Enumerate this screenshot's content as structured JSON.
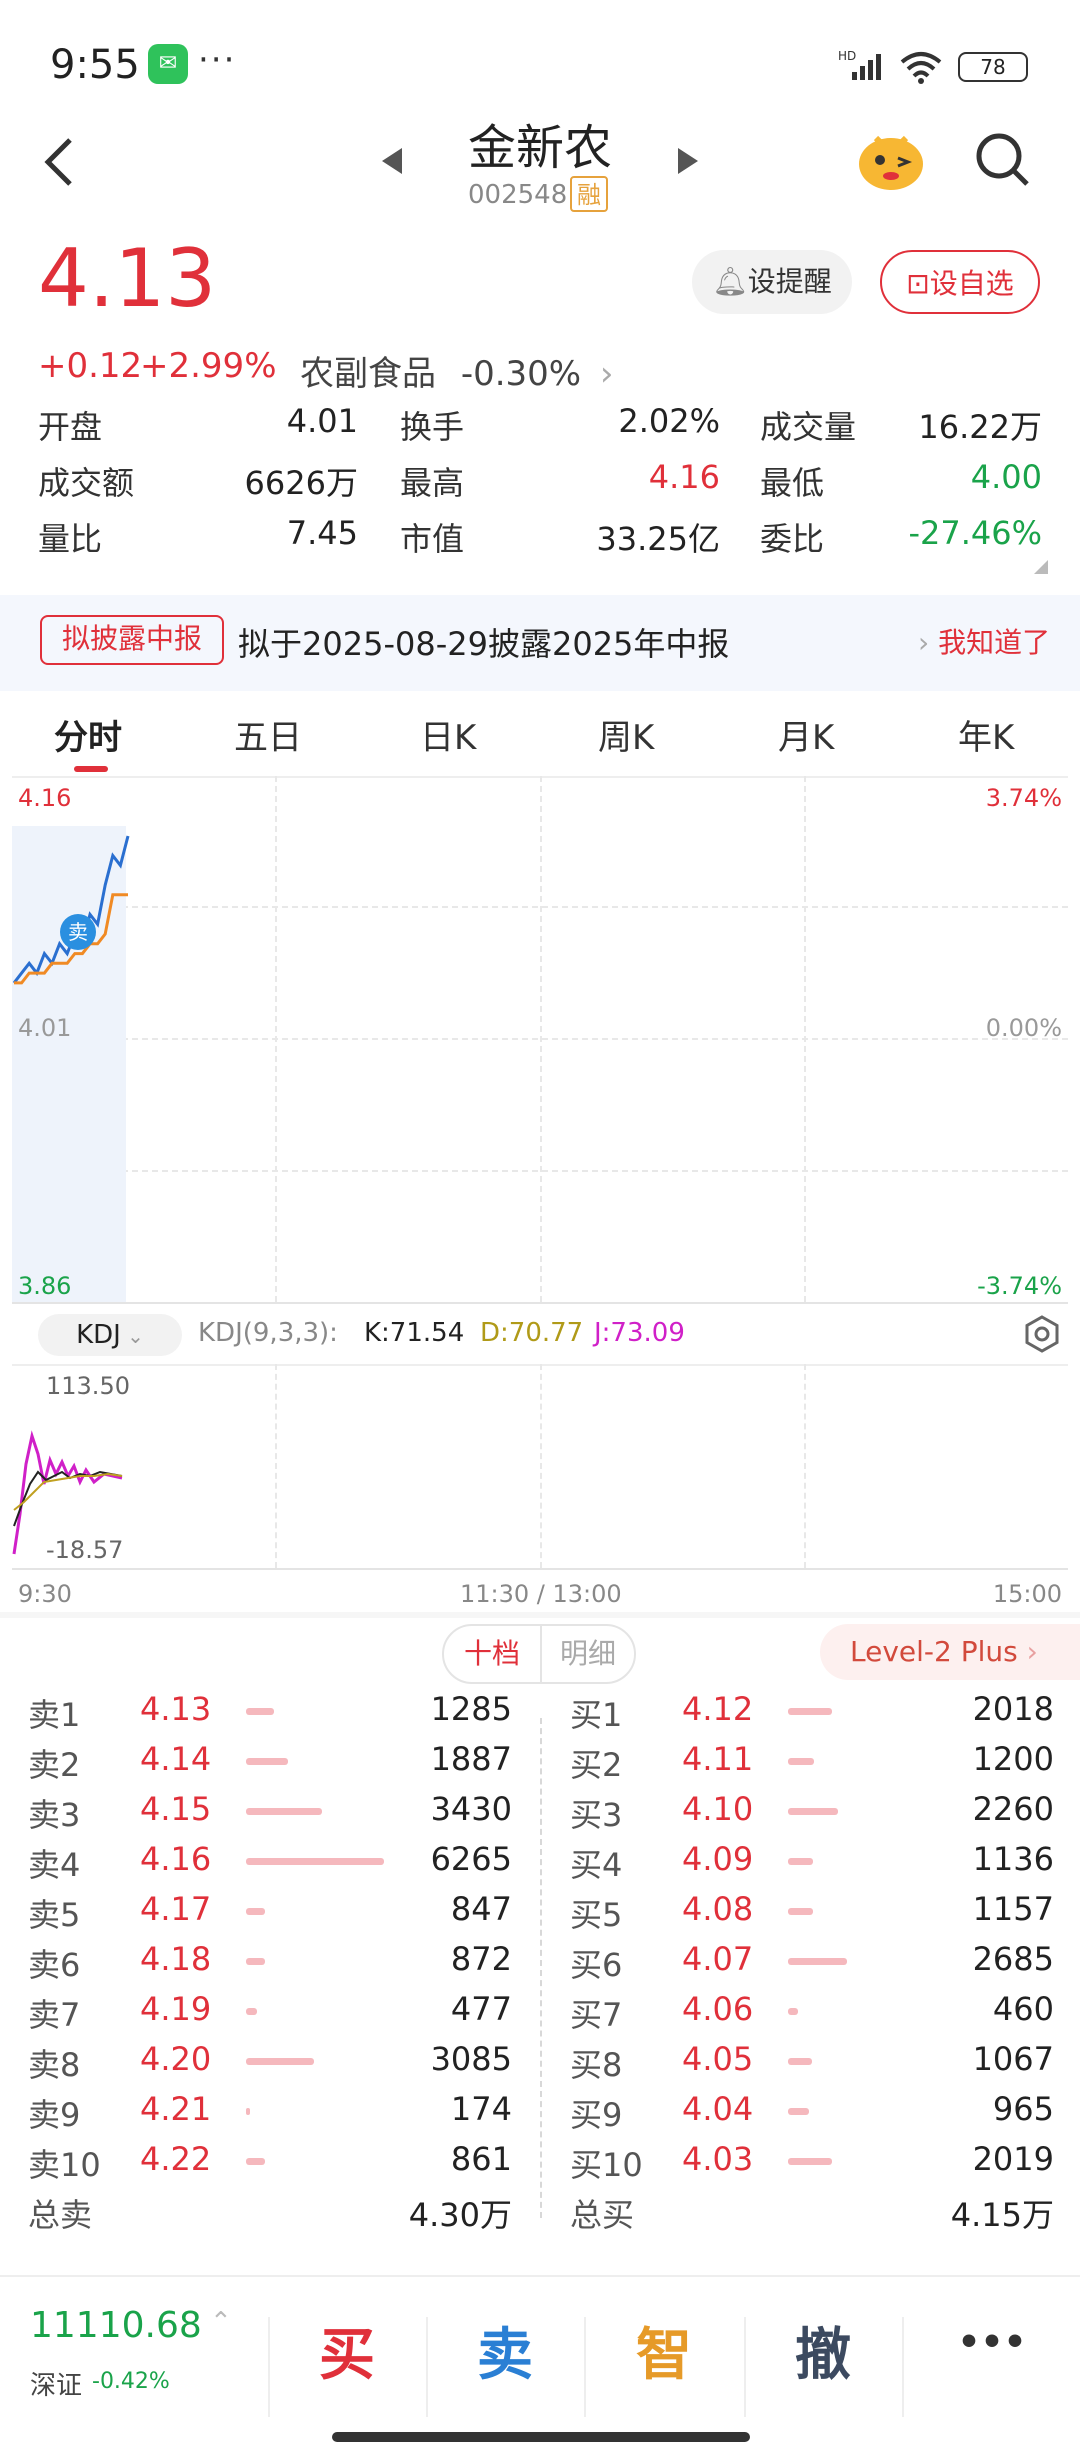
{
  "status": {
    "time": "9:55",
    "battery": "78"
  },
  "header": {
    "name": "金新农",
    "code": "002548",
    "tag": "融"
  },
  "quote": {
    "price": "4.13",
    "change": "+0.12",
    "change_pct": "+2.99%",
    "sector": "农副食品",
    "sector_pct": "-0.30%",
    "alert_label": "设提醒",
    "watch_label": "设自选"
  },
  "stats": [
    [
      {
        "label": "开盘",
        "value": "4.01",
        "color": "#222"
      },
      {
        "label": "换手",
        "value": "2.02%",
        "color": "#222"
      },
      {
        "label": "成交量",
        "value": "16.22万",
        "color": "#222"
      }
    ],
    [
      {
        "label": "成交额",
        "value": "6626万",
        "color": "#222"
      },
      {
        "label": "最高",
        "value": "4.16",
        "color": "#e0303a"
      },
      {
        "label": "最低",
        "value": "4.00",
        "color": "#1aa34a"
      }
    ],
    [
      {
        "label": "量比",
        "value": "7.45",
        "color": "#222"
      },
      {
        "label": "市值",
        "value": "33.25亿",
        "color": "#222"
      },
      {
        "label": "委比",
        "value": "-27.46%",
        "color": "#1aa34a"
      }
    ]
  ],
  "banner": {
    "tag": "拟披露中报",
    "text": "拟于2025-08-29披露2025年中报",
    "action": "我知道了"
  },
  "tabs": [
    "分时",
    "五日",
    "日K",
    "周K",
    "月K",
    "年K"
  ],
  "chart": {
    "price_high": "4.16",
    "price_mid": "4.01",
    "price_low": "3.86",
    "pct_high": "3.74%",
    "pct_mid": "0.00%",
    "pct_low": "-3.74%",
    "sell_marker": "卖",
    "kdj_selector": "KDJ",
    "kdj_param": "KDJ(9,3,3):",
    "k": "K:71.54",
    "d": "D:70.77",
    "j": "J:73.09",
    "kdj_max": "113.50",
    "kdj_min": "-18.57",
    "time_start": "9:30",
    "time_mid": "11:30 / 13:00",
    "time_end": "15:00"
  },
  "chart_data": {
    "type": "line",
    "series": [
      {
        "values": [
          4.01,
          4.02,
          4.03,
          4.02,
          4.04,
          4.03,
          4.05,
          4.04,
          4.06,
          4.05,
          4.08,
          4.07,
          4.11,
          4.14,
          4.13,
          4.16
        ]
      },
      {
        "values": [
          4.01,
          4.01,
          4.02,
          4.02,
          4.02,
          4.03,
          4.03,
          4.03,
          4.04,
          4.04,
          4.05,
          4.05,
          4.06,
          4.1,
          4.1,
          4.1
        ]
      }
    ],
    "ylim": [
      3.86,
      4.16
    ]
  },
  "orderbook": {
    "tab_ten": "十档",
    "tab_detail": "明细",
    "level2": "Level-2 Plus",
    "sells": [
      {
        "label": "卖1",
        "price": "4.13",
        "vol": "1285"
      },
      {
        "label": "卖2",
        "price": "4.14",
        "vol": "1887"
      },
      {
        "label": "卖3",
        "price": "4.15",
        "vol": "3430"
      },
      {
        "label": "卖4",
        "price": "4.16",
        "vol": "6265"
      },
      {
        "label": "卖5",
        "price": "4.17",
        "vol": "847"
      },
      {
        "label": "卖6",
        "price": "4.18",
        "vol": "872"
      },
      {
        "label": "卖7",
        "price": "4.19",
        "vol": "477"
      },
      {
        "label": "卖8",
        "price": "4.20",
        "vol": "3085"
      },
      {
        "label": "卖9",
        "price": "4.21",
        "vol": "174"
      },
      {
        "label": "卖10",
        "price": "4.22",
        "vol": "861"
      }
    ],
    "buys": [
      {
        "label": "买1",
        "price": "4.12",
        "vol": "2018"
      },
      {
        "label": "买2",
        "price": "4.11",
        "vol": "1200"
      },
      {
        "label": "买3",
        "price": "4.10",
        "vol": "2260"
      },
      {
        "label": "买4",
        "price": "4.09",
        "vol": "1136"
      },
      {
        "label": "买5",
        "price": "4.08",
        "vol": "1157"
      },
      {
        "label": "买6",
        "price": "4.07",
        "vol": "2685"
      },
      {
        "label": "买7",
        "price": "4.06",
        "vol": "460"
      },
      {
        "label": "买8",
        "price": "4.05",
        "vol": "1067"
      },
      {
        "label": "买9",
        "price": "4.04",
        "vol": "965"
      },
      {
        "label": "买10",
        "price": "4.03",
        "vol": "2019"
      }
    ],
    "total_sell_label": "总卖",
    "total_sell": "4.30万",
    "total_buy_label": "总买",
    "total_buy": "4.15万"
  },
  "bottom": {
    "index_value": "11110.68",
    "index_name": "深证",
    "index_pct": "-0.42%",
    "buy": "买",
    "sell": "卖",
    "smart": "智",
    "cancel": "撤",
    "more": "•••"
  }
}
